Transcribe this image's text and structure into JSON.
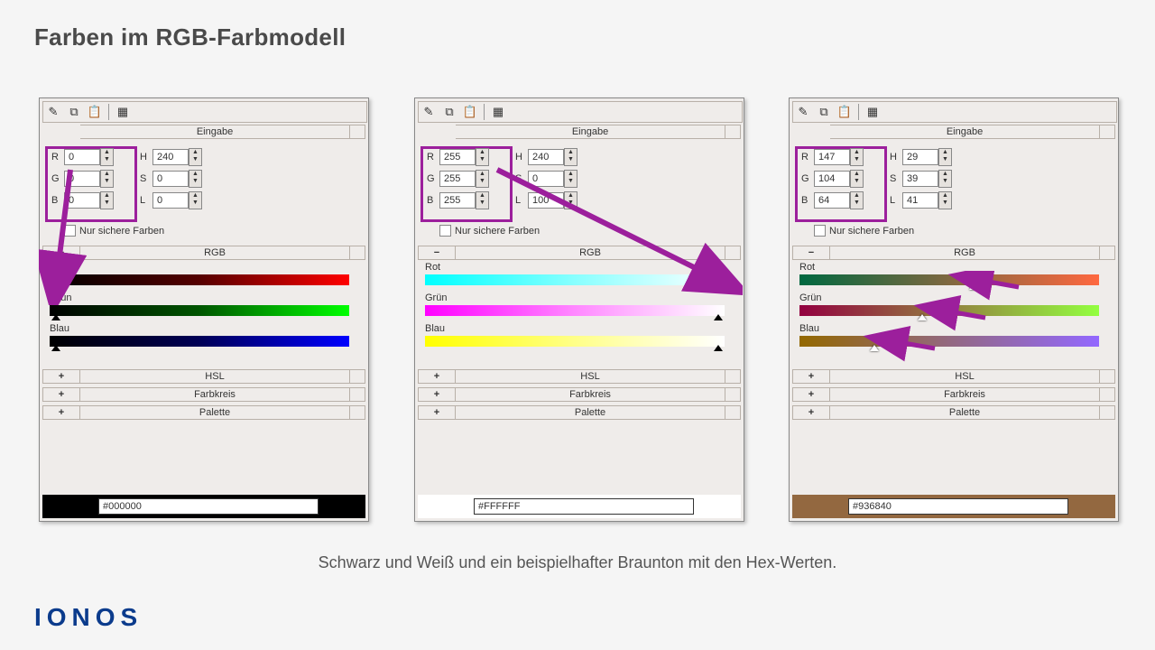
{
  "heading": "Farben im RGB-Farbmodell",
  "caption": "Schwarz und Weiß und ein beispielhafter Braunton mit den Hex-Werten.",
  "logo": "IONOS",
  "labels": {
    "eingabe": "Eingabe",
    "rgb": "RGB",
    "hsl": "HSL",
    "farbkreis": "Farbkreis",
    "palette": "Palette",
    "safe": "Nur sichere Farben",
    "R": "R",
    "G": "G",
    "B": "B",
    "H": "H",
    "S": "S",
    "L": "L",
    "rot": "Rot",
    "gruen": "Grün",
    "blau": "Blau",
    "plus": "+",
    "minus": "−"
  },
  "pickers": [
    {
      "R": "0",
      "G": "0",
      "B": "0",
      "H": "240",
      "S": "0",
      "L": "0",
      "hex": "#000000",
      "bg": "#000000",
      "grads": {
        "rot": "linear-gradient(90deg,#000,#500,#f00)",
        "gruen": "linear-gradient(90deg,#000,#050,#0f0)",
        "blau": "linear-gradient(90deg,#000,#005,#00f)"
      },
      "mark": {
        "r": 2,
        "g": 2,
        "b": 2
      },
      "white": false
    },
    {
      "R": "255",
      "G": "255",
      "B": "255",
      "H": "240",
      "S": "0",
      "L": "100",
      "hex": "#FFFFFF",
      "bg": "#ffffff",
      "grads": {
        "rot": "linear-gradient(90deg,#0ff,#8ff,#fff)",
        "gruen": "linear-gradient(90deg,#f0f,#f8f,#fff)",
        "blau": "linear-gradient(90deg,#ff0,#ff8,#fff)"
      },
      "mark": {
        "r": 98,
        "g": 98,
        "b": 98
      },
      "white": false
    },
    {
      "R": "147",
      "G": "104",
      "B": "64",
      "H": "29",
      "S": "39",
      "L": "41",
      "hex": "#936840",
      "bg": "#936840",
      "grads": {
        "rot": "linear-gradient(90deg,#006840,#806840,#ff6840)",
        "gruen": "linear-gradient(90deg,#930040,#938040,#93ff40)",
        "blau": "linear-gradient(90deg,#936800,#936880,#9368ff)"
      },
      "mark": {
        "r": 58,
        "g": 41,
        "b": 25
      },
      "white": true
    }
  ]
}
